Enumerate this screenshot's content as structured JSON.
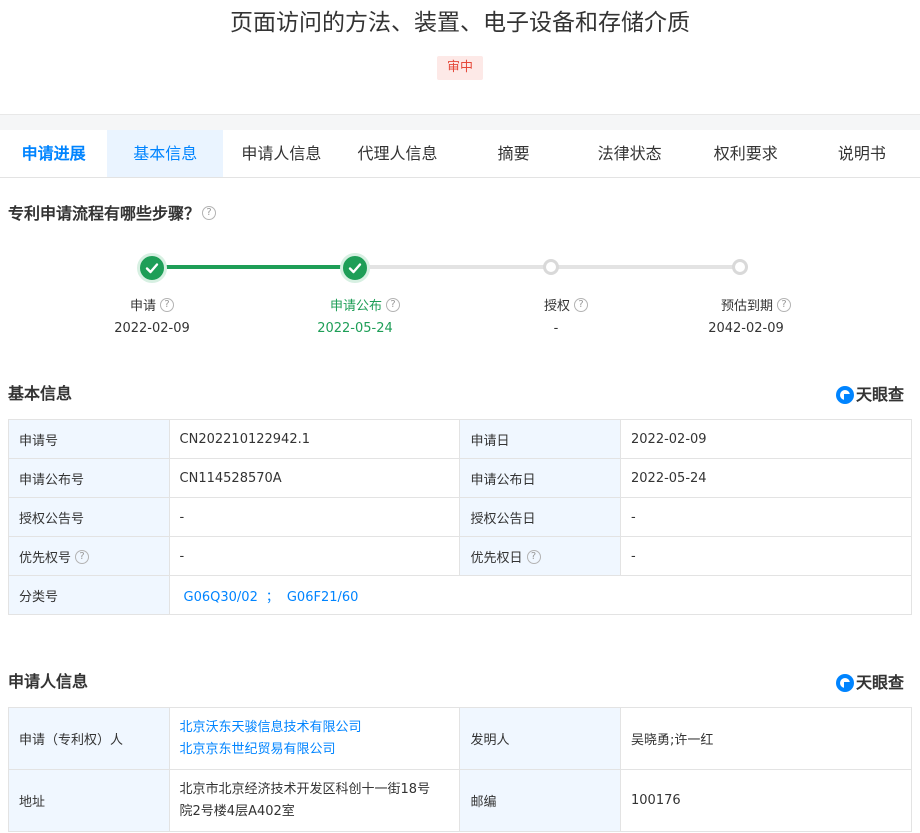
{
  "header": {
    "title": "页面访问的方法、装置、电子设备和存储介质",
    "status": "审中"
  },
  "tabs": [
    "申请进展",
    "基本信息",
    "申请人信息",
    "代理人信息",
    "摘要",
    "法律状态",
    "权利要求",
    "说明书"
  ],
  "progress": {
    "title": "专利申请流程有哪些步骤？",
    "steps": [
      {
        "label": "申请",
        "date": "2022-02-09",
        "state": "done"
      },
      {
        "label": "申请公布",
        "date": "2022-05-24",
        "state": "done"
      },
      {
        "label": "授权",
        "date": "-",
        "state": "pending"
      },
      {
        "label": "预估到期",
        "date": "2042-02-09",
        "state": "pending"
      }
    ]
  },
  "brand": "天眼查",
  "basic": {
    "title": "基本信息",
    "rows": [
      {
        "k1": "申请号",
        "v1": "CN202210122942.1",
        "k2": "申请日",
        "v2": "2022-02-09"
      },
      {
        "k1": "申请公布号",
        "v1": "CN114528570A",
        "k2": "申请公布日",
        "v2": "2022-05-24"
      },
      {
        "k1": "授权公告号",
        "v1": "-",
        "k2": "授权公告日",
        "v2": "-"
      },
      {
        "k1": "优先权号",
        "v1": "-",
        "k2": "优先权日",
        "v2": "-"
      }
    ],
    "classification": {
      "label": "分类号",
      "codes": [
        "G06Q30/02",
        "G06F21/60"
      ],
      "separator": "；"
    }
  },
  "applicant": {
    "title": "申请人信息",
    "applicant_label": "申请（专利权）人",
    "applicants": [
      "北京沃东天骏信息技术有限公司",
      "北京京东世纪贸易有限公司"
    ],
    "inventor_label": "发明人",
    "inventors": "吴晓勇;许一红",
    "address_label": "地址",
    "address_lines": [
      "北京市北京经济技术开发区科创十一街18号",
      "院2号楼4层A402室"
    ],
    "postcode_label": "邮编",
    "postcode": "100176"
  },
  "colors": {
    "accent": "#0084ff",
    "success": "#1e9e57",
    "status_bg": "#fde9e7",
    "status_text": "#e5493a"
  }
}
